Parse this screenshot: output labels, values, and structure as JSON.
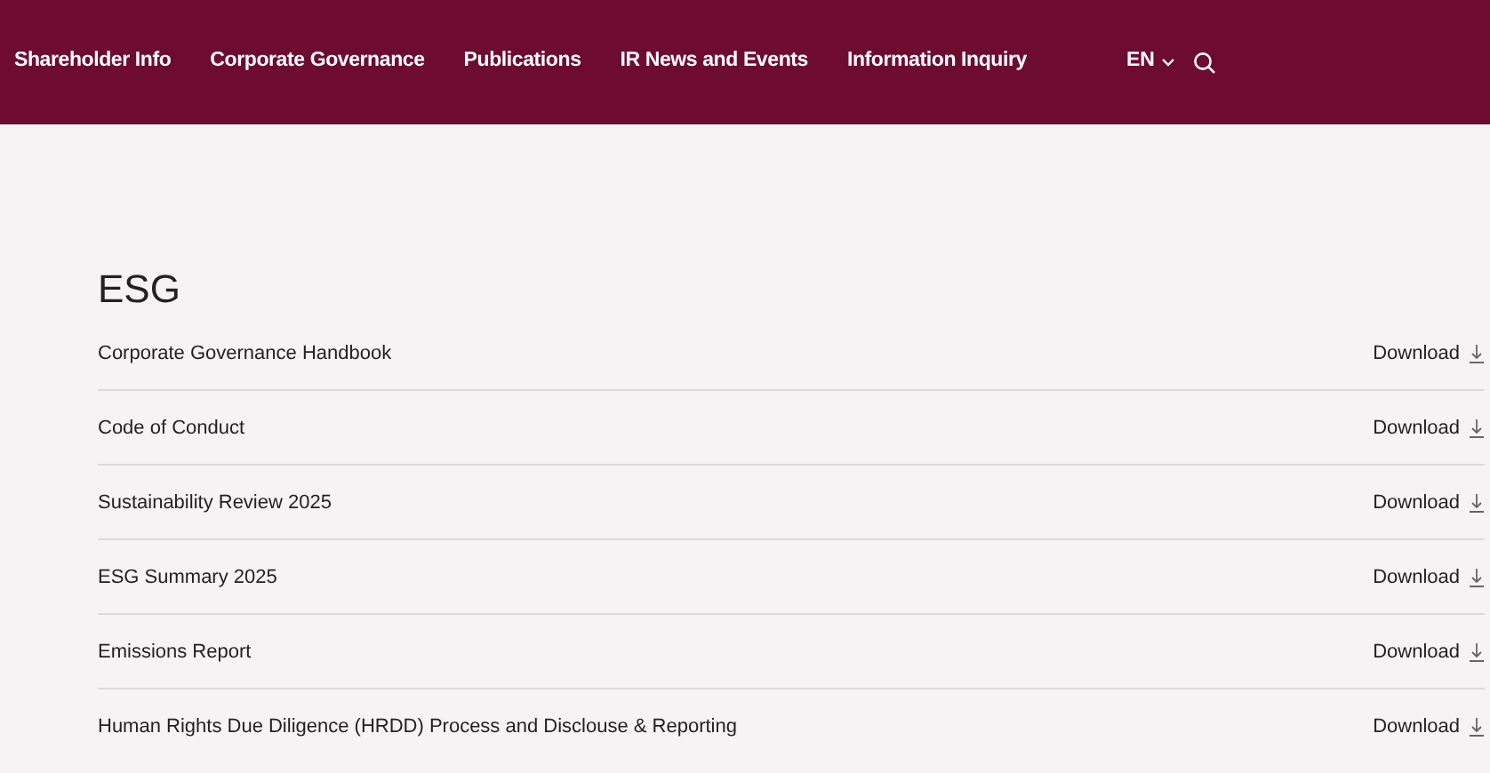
{
  "nav": {
    "items": [
      {
        "label": "Shareholder Info"
      },
      {
        "label": "Corporate Governance"
      },
      {
        "label": "Publications"
      },
      {
        "label": "IR News and Events"
      },
      {
        "label": "Information Inquiry"
      }
    ],
    "language": "EN"
  },
  "section": {
    "title": "ESG",
    "documents": [
      {
        "name": "Corporate Governance Handbook",
        "action": "Download"
      },
      {
        "name": "Code of Conduct",
        "action": "Download"
      },
      {
        "name": "Sustainability Review 2025",
        "action": "Download"
      },
      {
        "name": "ESG Summary 2025",
        "action": "Download"
      },
      {
        "name": "Emissions Report",
        "action": "Download"
      },
      {
        "name": "Human Rights Due Diligence (HRDD) Process and Disclouse & Reporting",
        "action": "Download"
      }
    ]
  }
}
